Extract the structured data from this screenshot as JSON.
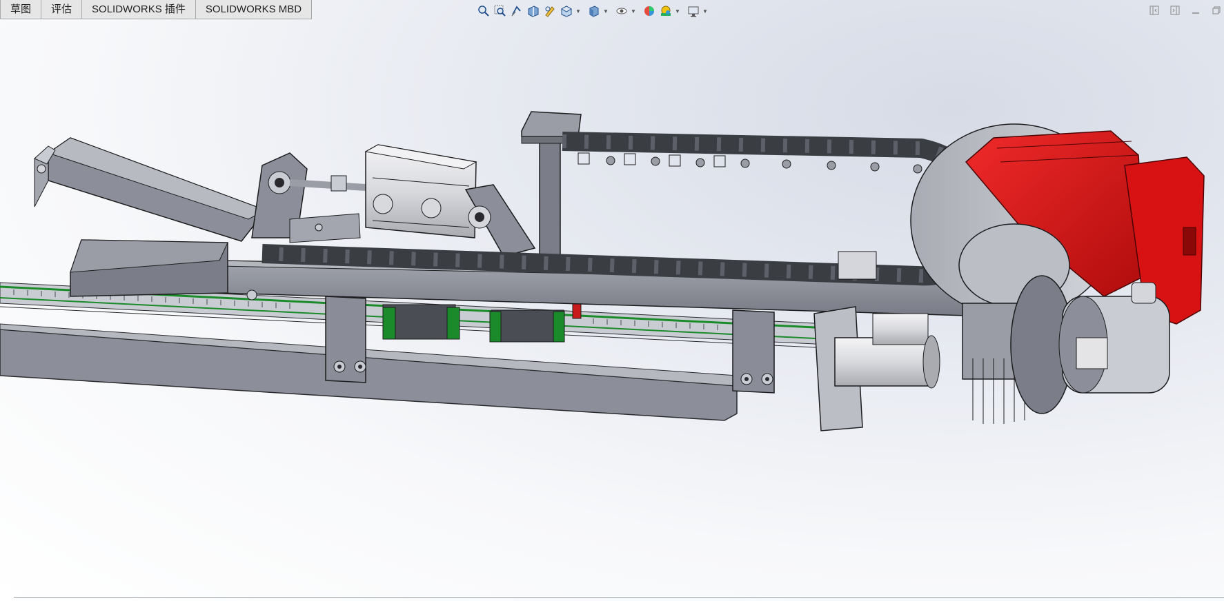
{
  "tabs": [
    {
      "label": "草图"
    },
    {
      "label": "评估"
    },
    {
      "label": "SOLIDWORKS 插件"
    },
    {
      "label": "SOLIDWORKS MBD"
    }
  ],
  "heads_up_toolbar": [
    {
      "icon": "zoom-to-fit-icon"
    },
    {
      "icon": "zoom-to-area-icon"
    },
    {
      "icon": "previous-view-icon"
    },
    {
      "icon": "section-view-icon"
    },
    {
      "icon": "dynamic-annotation-icon"
    },
    {
      "icon": "view-orientation-icon"
    },
    {
      "icon": "display-style-icon"
    },
    {
      "icon": "hide-show-items-icon"
    },
    {
      "icon": "edit-appearance-icon"
    },
    {
      "icon": "apply-scene-icon"
    },
    {
      "icon": "view-settings-icon"
    }
  ],
  "window_controls": [
    {
      "icon": "tile-left-icon"
    },
    {
      "icon": "tile-right-icon"
    },
    {
      "icon": "minimize-icon"
    },
    {
      "icon": "restore-icon"
    }
  ],
  "colors": {
    "steel": "#8a8d98",
    "steel_dark": "#5d6068",
    "chain": "#3a3d42",
    "motor_red": "#e01414",
    "rail_green": "#1a8a2a",
    "cylinder": "#e4e4e6",
    "background_top": "#d6dbe6",
    "background_bottom": "#ffffff"
  }
}
